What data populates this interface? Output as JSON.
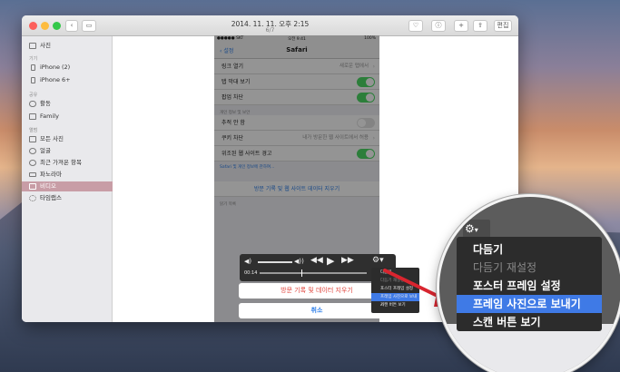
{
  "window": {
    "title": "2014. 11. 11. 오후 2:15",
    "subtitle": "6/7",
    "edit_label": "편집"
  },
  "sidebar": {
    "top_item": "사진",
    "devices_header": "기기",
    "devices": [
      "iPhone (2)",
      "iPhone 6+"
    ],
    "shared_header": "공유",
    "shared": [
      "활동",
      "Family"
    ],
    "albums_header": "앨범",
    "albums": [
      "모든 사진",
      "얼굴",
      "최근 가져온 항목",
      "파노라마",
      "비디오",
      "타임랩스"
    ],
    "selected_album": "비디오"
  },
  "phone": {
    "status_left": "●●●●● SKT",
    "status_time": "오전 9:41",
    "status_right": "100%",
    "back_label": "설정",
    "nav_title": "Safari",
    "rows": [
      {
        "label": "링크 열기",
        "value": "새로운 탭에서"
      },
      {
        "label": "탭 막대 보기"
      },
      {
        "label": "팝업 차단"
      }
    ],
    "privacy_header": "개인 정보 및 보안",
    "privacy_rows": [
      {
        "label": "추적 안 함"
      },
      {
        "label": "쿠키 차단",
        "value": "내가 방문한 웹 사이트에서 허용"
      },
      {
        "label": "위조된 웹 사이트 경고"
      }
    ],
    "privacy_link": "Safari 및 개인 정보에 관하여...",
    "clear_history": "방문 기록 및 웹 사이트 데이터 지우기",
    "reading_header": "읽기 목록"
  },
  "player": {
    "time_elapsed": "00:14"
  },
  "action_sheet": {
    "destructive": "방문 기록 및 데이터 지우기",
    "cancel": "취소"
  },
  "mini_menu": {
    "items": [
      "다듬기",
      "다듬기 재설정",
      "포스터 프레임 설정",
      "프레임 사진으로 보내기",
      "스캔 버튼 보기"
    ]
  },
  "zoom_menu": {
    "items": [
      "다듬기",
      "다듬기 재설정",
      "포스터 프레임 설정",
      "프레임 사진으로 보내기",
      "스캔 버튼 보기"
    ],
    "highlighted_index": 3,
    "disabled_index": 1
  },
  "colors": {
    "selection": "#c89da6",
    "highlight": "#3f7ae6",
    "toggle_on": "#4cd964",
    "destructive": "#e0443c",
    "arrow": "#d9252f"
  }
}
